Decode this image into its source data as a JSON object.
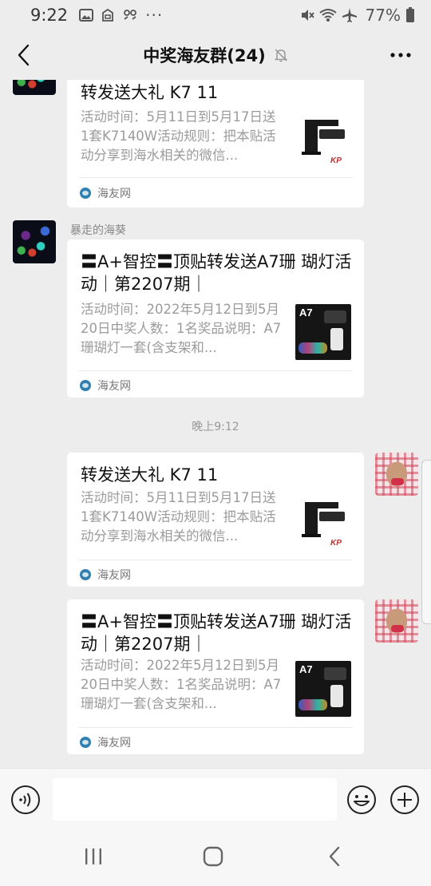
{
  "status_bar": {
    "time": "9:22",
    "left_icons": [
      "image-icon",
      "clipboard-icon",
      "link-icon"
    ],
    "more": "···",
    "right_icons": [
      "mute-icon",
      "wifi-icon",
      "airplane-icon"
    ],
    "battery_percent": "77%"
  },
  "header": {
    "title": "中奖海友群(24)",
    "muted_icon": "bell-off-icon",
    "more_label": "···"
  },
  "messages": [
    {
      "side": "left",
      "title": "转发送大礼 K7 11",
      "desc": "活动时间：5月11日到5月17日送1套K7140W活动规则：把本贴活动分享到海水相关的微信...",
      "thumb": "K7 lamp",
      "source": "海友网"
    },
    {
      "side": "left",
      "sender": "暴走的海葵",
      "title": "〓A+智控〓顶贴转发送A7珊 瑚灯活动｜第2207期｜",
      "desc": "活动时间：2022年5月12日到5月20日中奖人数：1名奖品说明：A7珊瑚灯一套(含支架和...",
      "thumb_label": "A7",
      "source": "海友网"
    },
    {
      "timestamp": "晚上9:12"
    },
    {
      "side": "right",
      "title": "转发送大礼 K7 11",
      "desc": "活动时间：5月11日到5月17日送1套K7140W活动规则：把本贴活动分享到海水相关的微信...",
      "thumb": "K7 lamp",
      "source": "海友网"
    },
    {
      "side": "right",
      "title": "〓A+智控〓顶贴转发送A7珊 瑚灯活动｜第2207期｜",
      "desc": "活动时间：2022年5月12日到5月20日中奖人数：1名奖品说明：A7珊瑚灯一套(含支架和...",
      "thumb_label": "A7",
      "source": "海友网"
    }
  ],
  "input_bar": {
    "text_value": "",
    "voice_icon": "voice-icon",
    "emoji_icon": "emoji-icon",
    "plus_icon": "plus-icon"
  },
  "nav_bar": [
    "recents-icon",
    "home-icon",
    "back-icon"
  ]
}
